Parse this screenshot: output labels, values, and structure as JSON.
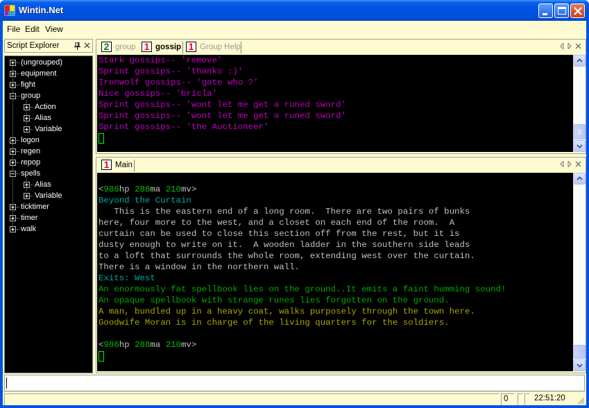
{
  "window": {
    "title": "Wintin.Net",
    "buttons": {
      "minimize": "minimize",
      "maximize": "maximize",
      "close": "close"
    }
  },
  "menu": {
    "items": [
      "File",
      "Edit",
      "View"
    ]
  },
  "explorer": {
    "title": "Script Explorer",
    "tree": [
      {
        "label": "(ungrouped)",
        "level": 0,
        "expanded": false
      },
      {
        "label": "equipment",
        "level": 0,
        "expanded": false
      },
      {
        "label": "fight",
        "level": 0,
        "expanded": false
      },
      {
        "label": "group",
        "level": 0,
        "expanded": true
      },
      {
        "label": "Action",
        "level": 1,
        "expanded": false
      },
      {
        "label": "Alias",
        "level": 1,
        "expanded": false
      },
      {
        "label": "Variable",
        "level": 1,
        "expanded": false
      },
      {
        "label": "logon",
        "level": 0,
        "expanded": false
      },
      {
        "label": "regen",
        "level": 0,
        "expanded": false
      },
      {
        "label": "repop",
        "level": 0,
        "expanded": false
      },
      {
        "label": "spells",
        "level": 0,
        "expanded": true
      },
      {
        "label": "Alias",
        "level": 1,
        "expanded": false
      },
      {
        "label": "Variable",
        "level": 1,
        "expanded": false
      },
      {
        "label": "ticktimer",
        "level": 0,
        "expanded": false
      },
      {
        "label": "timer",
        "level": 0,
        "expanded": false
      },
      {
        "label": "walk",
        "level": 0,
        "expanded": false
      }
    ]
  },
  "top_pane": {
    "tabs": [
      {
        "count": "2",
        "count_color": "#008000",
        "label": "group",
        "active": false
      },
      {
        "count": "1",
        "count_color": "#ff0000",
        "label": "gossip",
        "active": true
      },
      {
        "count": "1",
        "count_color": "#ff0000",
        "label": "Group Help",
        "active": false
      }
    ],
    "lines": [
      [
        {
          "t": "Stark gossips-- 'remove'",
          "c": "#c000c0"
        }
      ],
      [
        {
          "t": "Sprint gossips-- 'thanks :)'",
          "c": "#c000c0"
        }
      ],
      [
        {
          "t": "Ironwolf gossips-- 'gate who ?'",
          "c": "#c000c0"
        }
      ],
      [
        {
          "t": "Nice gossips-- 'bricla'",
          "c": "#c000c0"
        }
      ],
      [
        {
          "t": "Sprint gossips-- 'wont let me get a runed sword'",
          "c": "#c000c0"
        }
      ],
      [
        {
          "t": "Sprint gossips-- 'wont let me get a runed sword'",
          "c": "#c000c0"
        }
      ],
      [
        {
          "t": "Sprint gossips-- 'the Auctioneer'",
          "c": "#c000c0"
        }
      ]
    ]
  },
  "main_pane": {
    "tabs": [
      {
        "count": "1",
        "count_color": "#ff0000",
        "label": "Main",
        "active": true
      }
    ],
    "lines": [
      [],
      [
        {
          "t": "<",
          "c": "#c0c0c0"
        },
        {
          "t": "986",
          "c": "#00c000"
        },
        {
          "t": "hp ",
          "c": "#c0c0c0"
        },
        {
          "t": "288",
          "c": "#00c000"
        },
        {
          "t": "ma ",
          "c": "#c0c0c0"
        },
        {
          "t": "210",
          "c": "#00c000"
        },
        {
          "t": "mv>",
          "c": "#c0c0c0"
        }
      ],
      [
        {
          "t": "Beyond the Curtain",
          "c": "#00a8a8"
        }
      ],
      [
        {
          "t": "   This is the eastern end of a long room.  There are two pairs of bunks",
          "c": "#c0c0c0"
        }
      ],
      [
        {
          "t": "here, four more to the west, and a closet on each end of the room.  A",
          "c": "#c0c0c0"
        }
      ],
      [
        {
          "t": "curtain can be used to close this section off from the rest, but it is",
          "c": "#c0c0c0"
        }
      ],
      [
        {
          "t": "dusty enough to write on it.  A wooden ladder in the southern side leads",
          "c": "#c0c0c0"
        }
      ],
      [
        {
          "t": "to a loft that surrounds the whole room, extending west over the curtain.",
          "c": "#c0c0c0"
        }
      ],
      [
        {
          "t": "There is a window in the northern wall.",
          "c": "#c0c0c0"
        }
      ],
      [
        {
          "t": "Exits: West",
          "c": "#00a8a8"
        }
      ],
      [
        {
          "t": "An enormously fat spellbook lies on the ground..It emits a faint humming sound!",
          "c": "#00a800"
        }
      ],
      [
        {
          "t": "An opaque spellbook with strange runes lies forgotten on the ground.",
          "c": "#00a800"
        }
      ],
      [
        {
          "t": "A man, bundled up in a heavy coat, walks purposely through the town here.",
          "c": "#a8a800"
        }
      ],
      [
        {
          "t": "Goodwife Moran is in charge of the living quarters for the soldiers.",
          "c": "#a8a800"
        }
      ],
      [],
      [
        {
          "t": "<",
          "c": "#c0c0c0"
        },
        {
          "t": "986",
          "c": "#00c000"
        },
        {
          "t": "hp ",
          "c": "#c0c0c0"
        },
        {
          "t": "288",
          "c": "#00c000"
        },
        {
          "t": "ma ",
          "c": "#c0c0c0"
        },
        {
          "t": "210",
          "c": "#00c000"
        },
        {
          "t": "mv>",
          "c": "#c0c0c0"
        }
      ]
    ]
  },
  "command_input": {
    "value": "",
    "placeholder": ""
  },
  "status": {
    "panels": [
      "",
      "0",
      "",
      "",
      "22:51:20"
    ]
  },
  "colors": {
    "titlebar": "#0054e3",
    "client_bg": "#fffbd0",
    "terminal_bg": "#000000",
    "cursor": "#00ff00"
  }
}
